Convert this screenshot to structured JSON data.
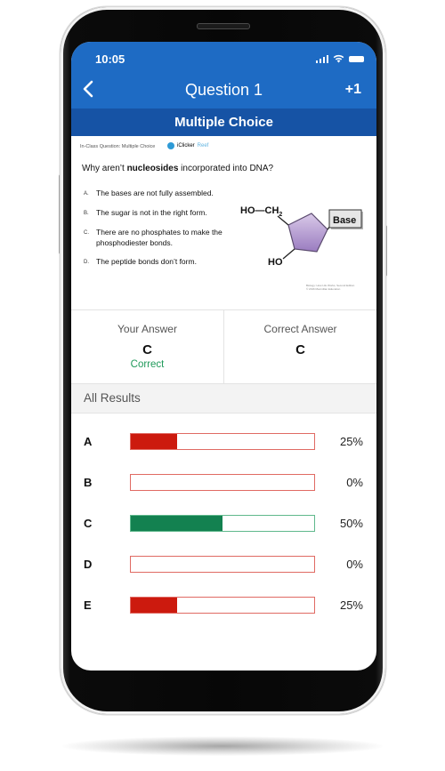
{
  "status_bar": {
    "time": "10:05",
    "icons": [
      "signal-icon",
      "wifi-icon",
      "battery-icon"
    ]
  },
  "header": {
    "back_icon": "chevron-left-icon",
    "title": "Question 1",
    "action_label": "+1"
  },
  "subheader": {
    "label": "Multiple Choice"
  },
  "question": {
    "meta": "In-Class Question: Multiple Choice",
    "brand_name": "iClicker",
    "brand_suffix": "Reef",
    "text_before": "Why aren’t ",
    "text_bold": "nucleosides",
    "text_after": " incorporated into DNA?",
    "options": [
      {
        "key": "A.",
        "text": "The bases are not fully assembled."
      },
      {
        "key": "B.",
        "text": "The sugar is not in the right form."
      },
      {
        "key": "C.",
        "text": "There are no phosphates to make the phosphodiester bonds."
      },
      {
        "key": "D.",
        "text": "The peptide bonds don’t form."
      }
    ],
    "diagram": {
      "top_label": "HO—CH",
      "top_sub": "2",
      "side_label": "HO",
      "box_label": "Base"
    },
    "credit_line1": "Biology: How Life Works, Second Edition",
    "credit_line2": "© 2016 Macmillan Education"
  },
  "answers": {
    "yours": {
      "label": "Your Answer",
      "value": "C",
      "status": "Correct"
    },
    "correct": {
      "label": "Correct Answer",
      "value": "C"
    }
  },
  "results": {
    "heading": "All Results",
    "colors": {
      "wrong": "#cc1a0e",
      "wrong_border": "#e06a63",
      "correct": "#138150",
      "correct_border": "#5fb88c"
    },
    "rows": [
      {
        "letter": "A",
        "percent": 25,
        "label": "25%",
        "correct": false
      },
      {
        "letter": "B",
        "percent": 0,
        "label": "0%",
        "correct": false
      },
      {
        "letter": "C",
        "percent": 50,
        "label": "50%",
        "correct": true
      },
      {
        "letter": "D",
        "percent": 0,
        "label": "0%",
        "correct": false
      },
      {
        "letter": "E",
        "percent": 25,
        "label": "25%",
        "correct": false
      }
    ]
  }
}
